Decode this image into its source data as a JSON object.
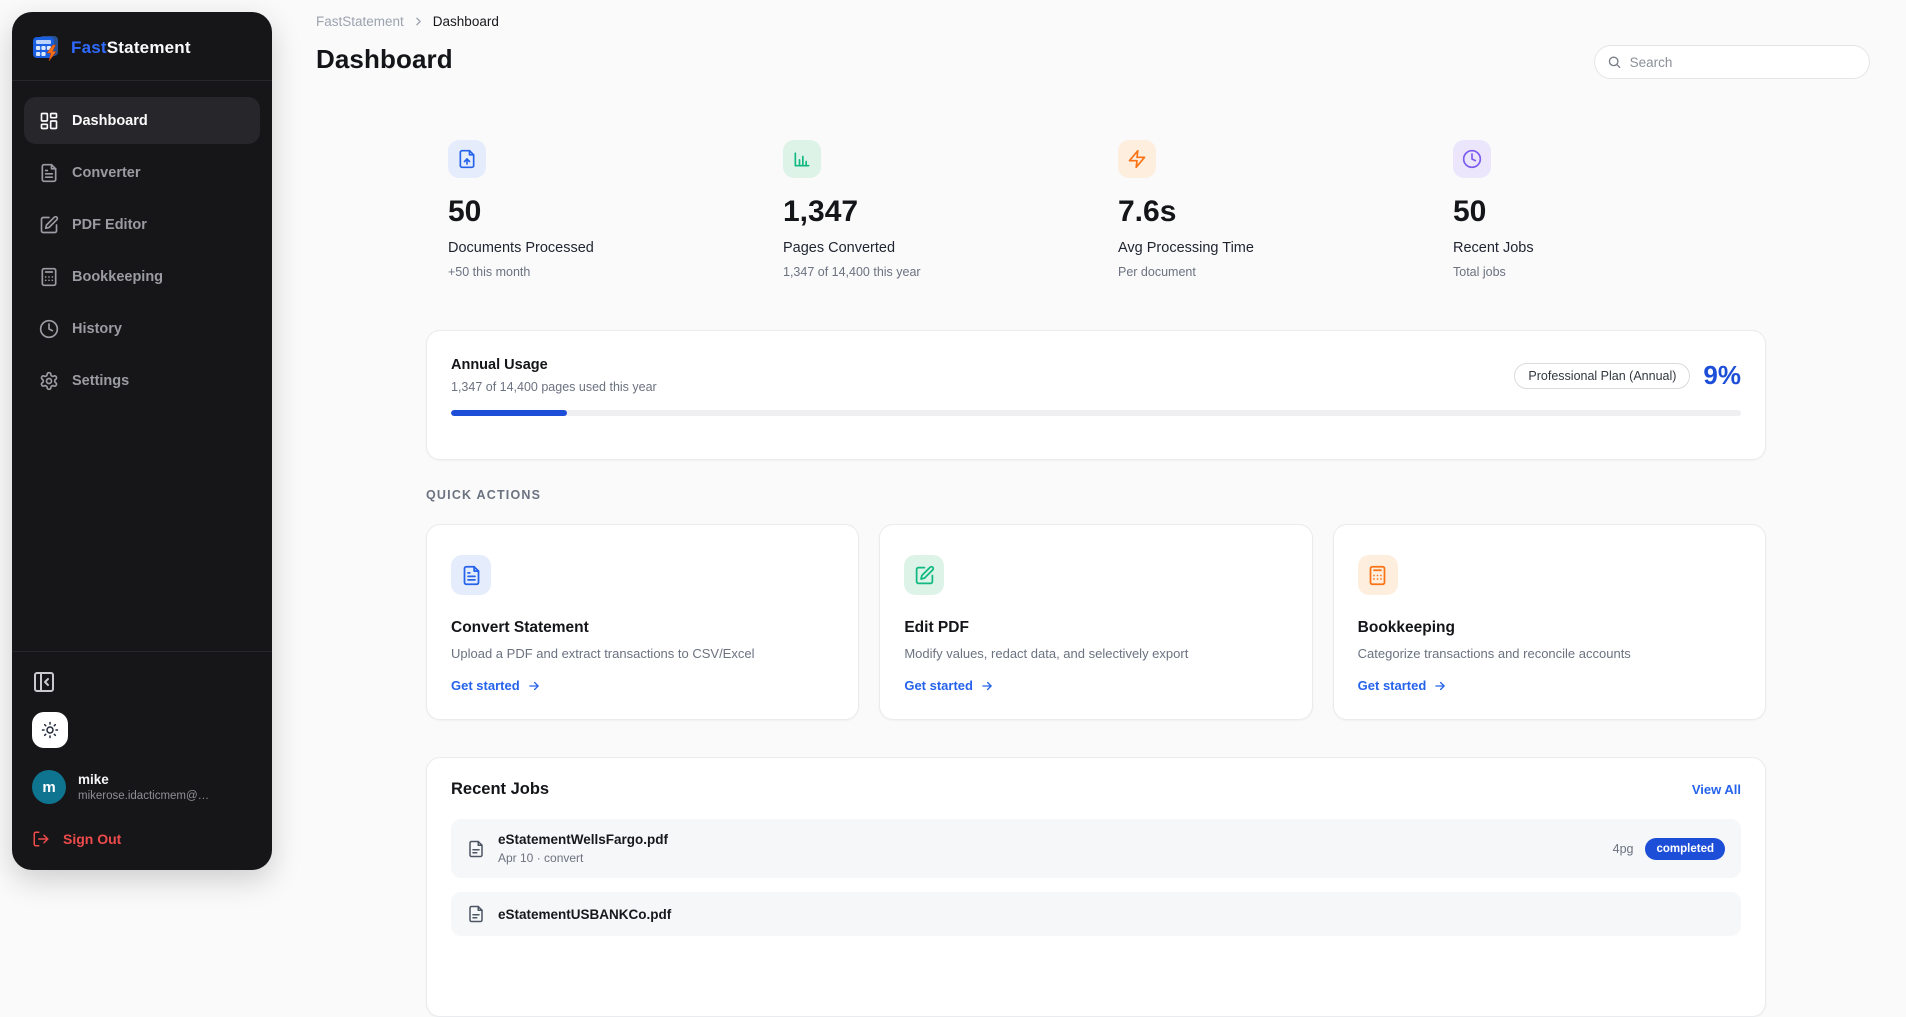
{
  "app": {
    "brand_fast": "Fast",
    "brand_statement": "Statement"
  },
  "sidebar": {
    "items": [
      {
        "label": "Dashboard",
        "active": true
      },
      {
        "label": "Converter",
        "active": false
      },
      {
        "label": "PDF Editor",
        "active": false
      },
      {
        "label": "Bookkeeping",
        "active": false
      },
      {
        "label": "History",
        "active": false
      },
      {
        "label": "Settings",
        "active": false
      }
    ],
    "user": {
      "initial": "m",
      "name": "mike",
      "email": "mikerose.idacticmem@…"
    },
    "sign_out_label": "Sign Out"
  },
  "header": {
    "breadcrumb_root": "FastStatement",
    "breadcrumb_current": "Dashboard",
    "title": "Dashboard",
    "search_placeholder": "Search"
  },
  "stats": [
    {
      "value": "50",
      "label": "Documents Processed",
      "sub": "+50 this month",
      "icon": "file-up-icon",
      "color": "#2563eb"
    },
    {
      "value": "1,347",
      "label": "Pages Converted",
      "sub": "1,347 of 14,400 this year",
      "icon": "bar-chart-icon",
      "color": "#10b981"
    },
    {
      "value": "7.6s",
      "label": "Avg Processing Time",
      "sub": "Per document",
      "icon": "zap-icon",
      "color": "#f97316"
    },
    {
      "value": "50",
      "label": "Recent Jobs",
      "sub": "Total jobs",
      "icon": "clock-icon",
      "color": "#7c5cf0"
    }
  ],
  "usage": {
    "title": "Annual Usage",
    "subtitle": "1,347 of 14,400 pages used this year",
    "plan_badge": "Professional Plan (Annual)",
    "percent_label": "9%",
    "percent": 9,
    "bar_color": "#1d4ed8"
  },
  "quick_actions": {
    "heading": "QUICK ACTIONS",
    "cards": [
      {
        "title": "Convert Statement",
        "desc": "Upload a PDF and extract transactions to CSV/Excel",
        "cta": "Get started",
        "icon": "file-text-icon",
        "color": "#2563eb"
      },
      {
        "title": "Edit PDF",
        "desc": "Modify values, redact data, and selectively export",
        "cta": "Get started",
        "icon": "edit-pen-icon",
        "color": "#10b981"
      },
      {
        "title": "Bookkeeping",
        "desc": "Categorize transactions and reconcile accounts",
        "cta": "Get started",
        "icon": "calculator-icon",
        "color": "#f59e0b"
      }
    ]
  },
  "recent_jobs": {
    "title": "Recent Jobs",
    "view_all_label": "View All",
    "jobs": [
      {
        "filename": "eStatementWellsFargo.pdf",
        "meta": "Apr 10 · convert",
        "pages": "4pg",
        "status": "completed"
      },
      {
        "filename": "eStatementUSBANKCo.pdf",
        "meta": "",
        "pages": "",
        "status": ""
      }
    ]
  }
}
